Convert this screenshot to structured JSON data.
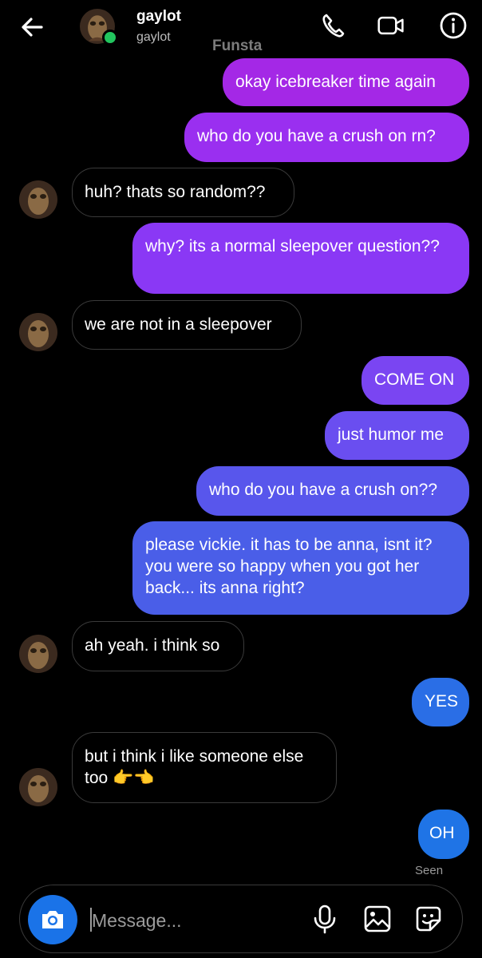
{
  "header": {
    "name": "gaylot",
    "username": "gaylot",
    "watermark": "Funsta",
    "icons": [
      "back-arrow-icon",
      "phone-icon",
      "video-camera-icon",
      "info-icon"
    ],
    "online_color": "#22c55e"
  },
  "messages": [
    {
      "from": "me",
      "text": "okay icebreaker time again",
      "color": "#a428e6"
    },
    {
      "from": "me",
      "text": "who do you have a crush on rn?",
      "color": "#9a2ff0"
    },
    {
      "from": "them",
      "text": "huh? thats so random??"
    },
    {
      "from": "me",
      "text": "why? its a normal sleepover question??",
      "color": "#8a38f5"
    },
    {
      "from": "them",
      "text": "we are not in a sleepover"
    },
    {
      "from": "me",
      "text": "COME ON",
      "color": "#7a45f2"
    },
    {
      "from": "me",
      "text": "just humor me",
      "color": "#6a4ef0"
    },
    {
      "from": "me",
      "text": "who do you have a crush on??",
      "color": "#5856ec"
    },
    {
      "from": "me",
      "text": "please vickie. it has to be anna, isnt it? you were so happy when you got her back... its anna right?",
      "color": "#4a5ee8"
    },
    {
      "from": "them",
      "text": "ah yeah. i think so"
    },
    {
      "from": "me",
      "text": "YES",
      "color": "#2a6ee6"
    },
    {
      "from": "them",
      "text": "but i think i like someone else too 👉👈"
    },
    {
      "from": "me",
      "text": "OH",
      "color": "#1f74e6"
    }
  ],
  "status": {
    "seen": "Seen"
  },
  "composer": {
    "placeholder": "Message...",
    "icons": [
      "camera-icon",
      "microphone-icon",
      "gallery-icon",
      "sticker-icon"
    ],
    "camera_color": "#1a73e8"
  }
}
